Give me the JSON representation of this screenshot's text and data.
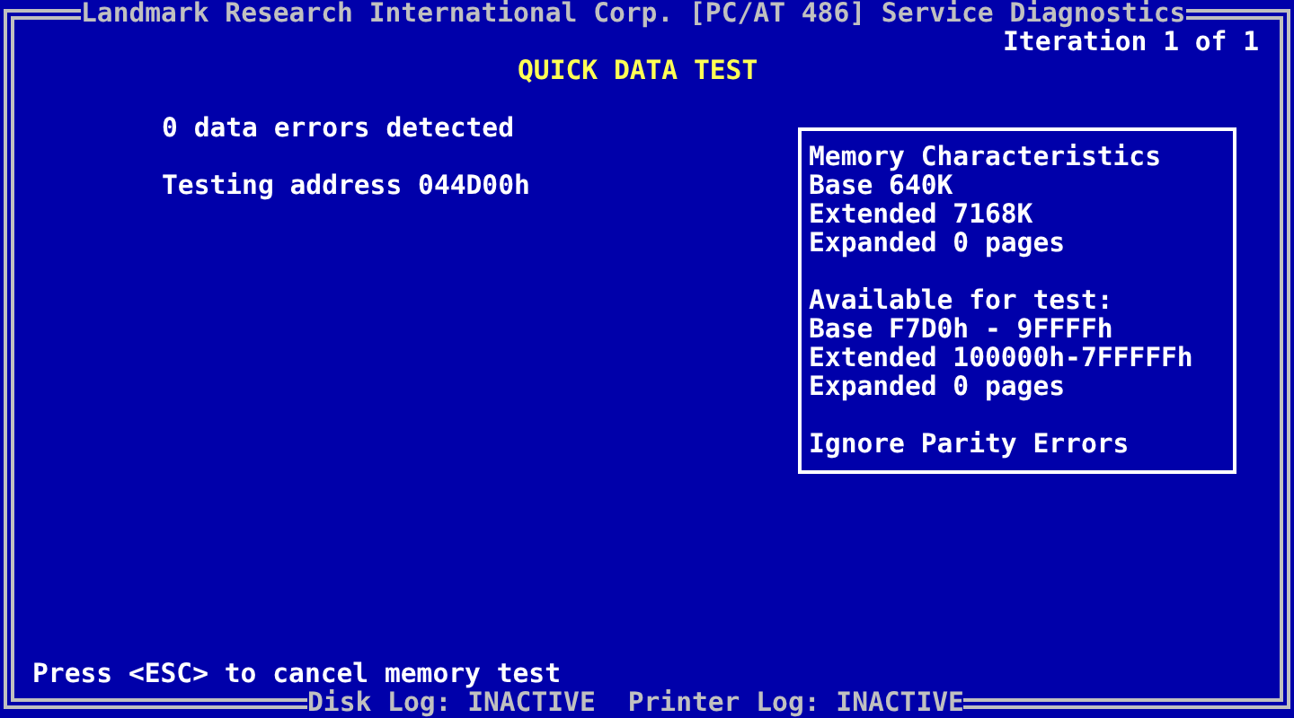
{
  "window": {
    "title": "Landmark Research International Corp. [PC/AT 486] Service Diagnostics"
  },
  "iteration": "Iteration 1 of 1",
  "test_title": "QUICK DATA TEST",
  "messages": [
    "0 data errors detected",
    "Testing address 044D00h"
  ],
  "memory_panel": {
    "sections": [
      {
        "lines": [
          "Memory Characteristics",
          "Base 640K",
          "Extended 7168K",
          "Expanded 0 pages"
        ]
      },
      {
        "lines": [
          "Available for test:",
          "Base F7D0h - 9FFFFh",
          "Extended 100000h-7FFFFFh",
          "Expanded 0 pages"
        ]
      },
      {
        "lines": [
          "Ignore Parity Errors"
        ]
      }
    ]
  },
  "prompt": "Press <ESC> to cancel memory test",
  "status_bar": [
    "Disk Log: INACTIVE",
    "Printer Log: INACTIVE"
  ]
}
